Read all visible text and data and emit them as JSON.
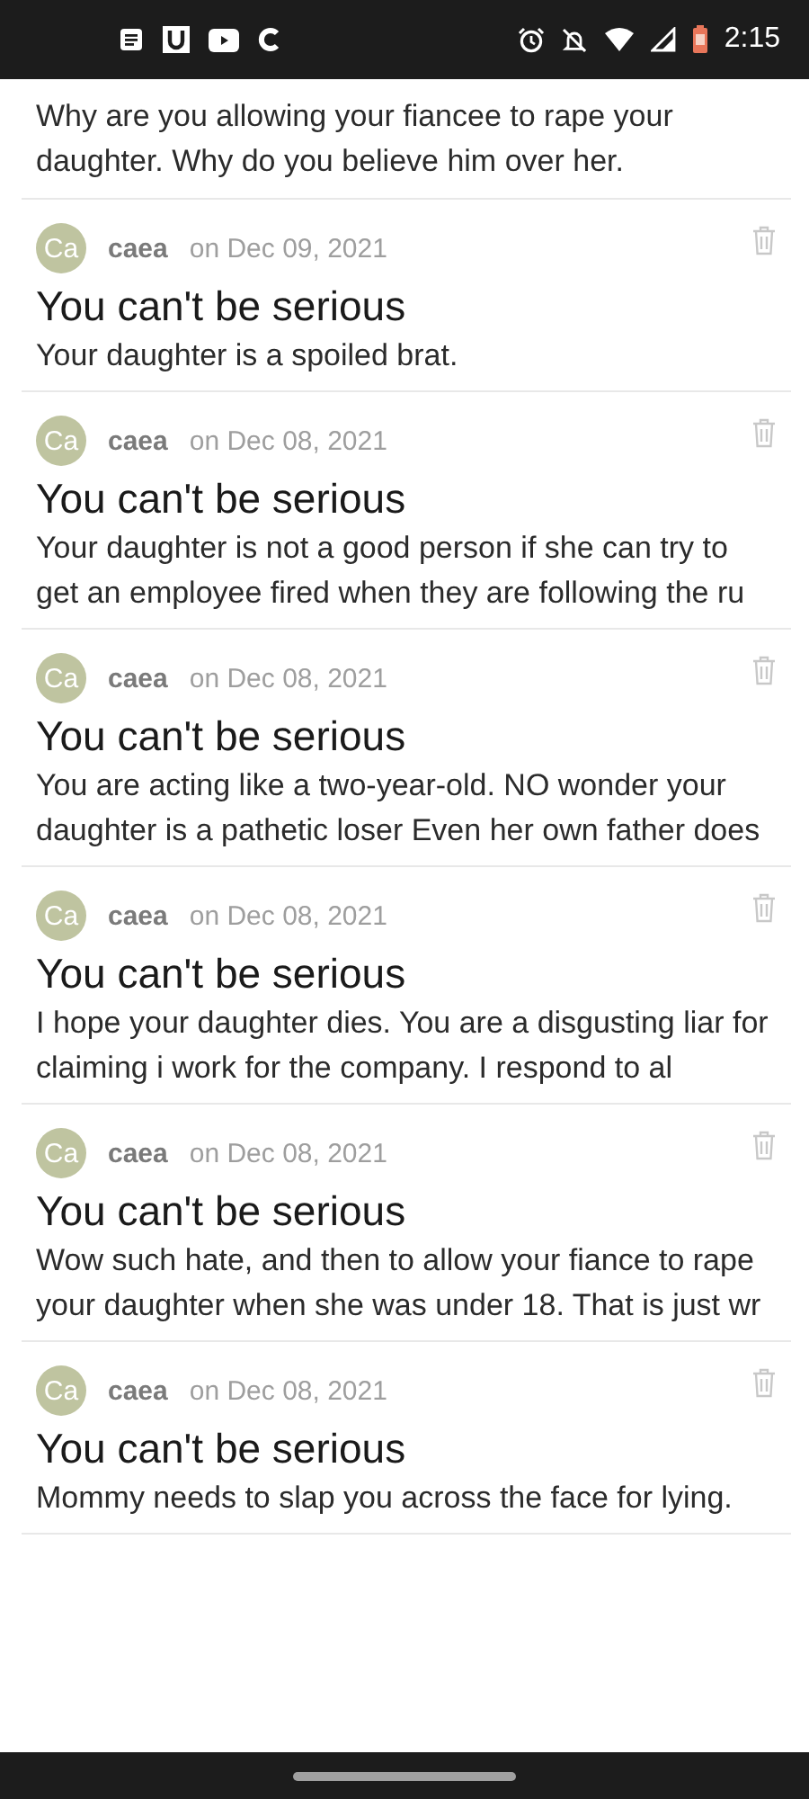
{
  "status_bar": {
    "time": "2:15"
  },
  "partial_comment": {
    "body": "Why are you allowing your fiancee to rape your daughter. Why do you believe him over her."
  },
  "comments": [
    {
      "avatar": "Ca",
      "user": "caea",
      "date": "on Dec 09, 2021",
      "title": "You can't be serious",
      "body": "Your daughter is a spoiled brat."
    },
    {
      "avatar": "Ca",
      "user": "caea",
      "date": "on Dec 08, 2021",
      "title": "You can't be serious",
      "body": "Your daughter is not a good person if she can try to get an employee fired when they are following the ru"
    },
    {
      "avatar": "Ca",
      "user": "caea",
      "date": "on Dec 08, 2021",
      "title": "You can't be serious",
      "body": "You are acting like a two-year-old. NO wonder your daughter is a pathetic loser Even her own father does"
    },
    {
      "avatar": "Ca",
      "user": "caea",
      "date": "on Dec 08, 2021",
      "title": "You can't be serious",
      "body": "I hope your daughter dies. You are a disgusting liar for claiming i work for the company. I respond to al"
    },
    {
      "avatar": "Ca",
      "user": "caea",
      "date": "on Dec 08, 2021",
      "title": "You can't be serious",
      "body": "Wow such hate, and then to allow your fiance to rape your daughter when she was under 18. That is just wr"
    },
    {
      "avatar": "Ca",
      "user": "caea",
      "date": "on Dec 08, 2021",
      "title": "You can't be serious",
      "body": "Mommy needs to slap you across the face for lying."
    }
  ]
}
